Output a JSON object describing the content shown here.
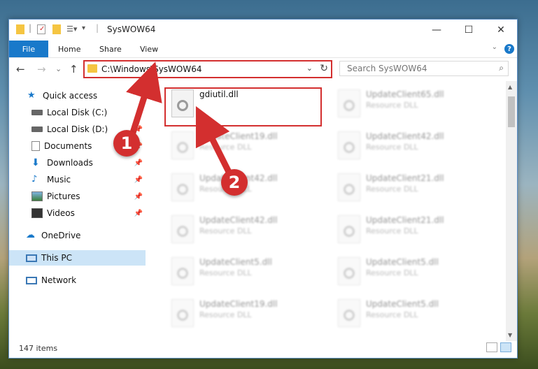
{
  "window": {
    "title": "SysWOW64",
    "minimize": "—",
    "maximize": "☐",
    "close": "✕"
  },
  "ribbon": {
    "file": "File",
    "home": "Home",
    "share": "Share",
    "view": "View",
    "help": "?"
  },
  "nav": {
    "back": "←",
    "forward": "→",
    "recent": "⌄",
    "up": "↑",
    "address_path": "C:\\Windows\\SysWOW64",
    "refresh": "↻",
    "search_placeholder": "Search SysWOW64",
    "search_icon": "search-icon"
  },
  "sidebar": {
    "items": [
      {
        "label": "Quick access",
        "icon": "star-icon"
      },
      {
        "label": "Local Disk (C:)",
        "icon": "drive-icon"
      },
      {
        "label": "Local Disk (D:)",
        "icon": "drive-icon"
      },
      {
        "label": "Documents",
        "icon": "documents-icon"
      },
      {
        "label": "Downloads",
        "icon": "download-icon"
      },
      {
        "label": "Music",
        "icon": "music-icon"
      },
      {
        "label": "Pictures",
        "icon": "pictures-icon"
      },
      {
        "label": "Videos",
        "icon": "videos-icon"
      },
      {
        "label": "OneDrive",
        "icon": "cloud-icon"
      },
      {
        "label": "This PC",
        "icon": "pc-icon"
      },
      {
        "label": "Network",
        "icon": "network-icon"
      }
    ]
  },
  "files": {
    "highlighted": {
      "name": "gdiutil.dll",
      "type": ""
    },
    "left_column": [
      {
        "name": "UpdateClient19.dll",
        "type": "Resource DLL"
      },
      {
        "name": "UpdateClient42.dll",
        "type": "Resource DLL"
      },
      {
        "name": "UpdateClient42.dll",
        "type": "Resource DLL"
      },
      {
        "name": "UpdateClient5.dll",
        "type": "Resource DLL"
      },
      {
        "name": "UpdateClient19.dll",
        "type": "Resource DLL"
      }
    ],
    "right_column": [
      {
        "name": "UpdateClient65.dll",
        "type": "Resource DLL"
      },
      {
        "name": "UpdateClient42.dll",
        "type": "Resource DLL"
      },
      {
        "name": "UpdateClient21.dll",
        "type": "Resource DLL"
      },
      {
        "name": "UpdateClient21.dll",
        "type": "Resource DLL"
      },
      {
        "name": "UpdateClient5.dll",
        "type": "Resource DLL"
      },
      {
        "name": "UpdateClient5.dll",
        "type": "Resource DLL"
      }
    ]
  },
  "status": {
    "item_count": "147 items"
  },
  "callouts": {
    "one": "1",
    "two": "2"
  },
  "colors": {
    "accent": "#1979ca",
    "callout": "#d32f2f",
    "selected": "#cce4f7"
  }
}
